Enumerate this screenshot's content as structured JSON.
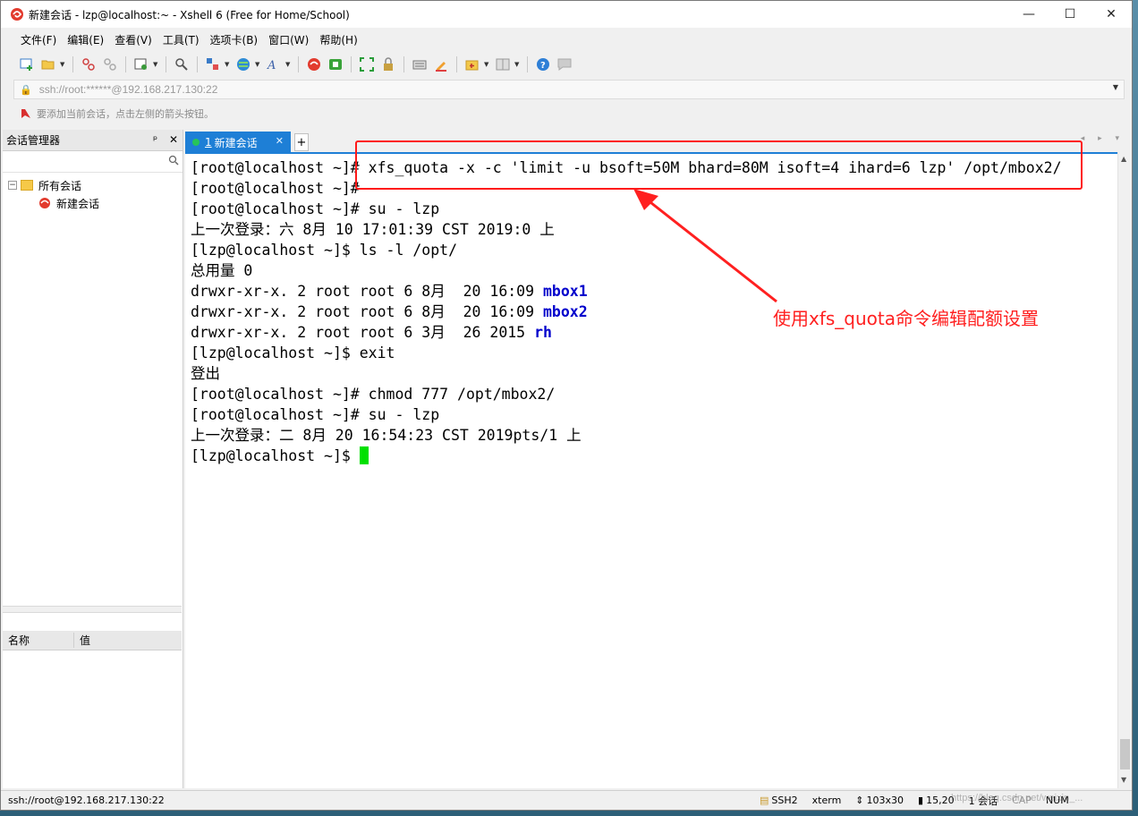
{
  "window": {
    "title": "新建会话 - lzp@localhost:~ - Xshell 6 (Free for Home/School)",
    "controls": {
      "minimize": "—",
      "maximize": "☐",
      "close": "✕"
    }
  },
  "menu": [
    "文件(F)",
    "编辑(E)",
    "查看(V)",
    "工具(T)",
    "选项卡(B)",
    "窗口(W)",
    "帮助(H)"
  ],
  "address": {
    "value": "ssh://root:******@192.168.217.130:22",
    "hint": "要添加当前会话，点击左侧的箭头按钮。"
  },
  "session_manager": {
    "title": "会话管理器",
    "pin": "ᵖ",
    "close": "✕",
    "tree": {
      "root": "所有会话",
      "root_toggle": "−",
      "child": "新建会话"
    },
    "props_headers": [
      "名称",
      "值"
    ]
  },
  "tabs": {
    "active_index": "1",
    "active_label": "新建会话",
    "close": "✕",
    "add": "+",
    "nav": "◂ ▸ ▾"
  },
  "terminal": {
    "lines": [
      {
        "text": "[root@localhost ~]# xfs_quota -x -c 'limit -u bsoft=50M bhard=80M isoft=4 ihard=6 lzp' /opt/mbox2/"
      },
      {
        "text": "[root@localhost ~]#"
      },
      {
        "text": "[root@localhost ~]# su - lzp"
      },
      {
        "text": "上一次登录：六 8月 10 17:01:39 CST 2019:0 上"
      },
      {
        "text": "[lzp@localhost ~]$ ls -l /opt/"
      },
      {
        "text": "总用量 0"
      },
      {
        "text": "drwxr-xr-x. 2 root root 6 8月  20 16:09 ",
        "dir": "mbox1"
      },
      {
        "text": "drwxr-xr-x. 2 root root 6 8月  20 16:09 ",
        "dir": "mbox2"
      },
      {
        "text": "drwxr-xr-x. 2 root root 6 3月  26 2015 ",
        "dir": "rh"
      },
      {
        "text": "[lzp@localhost ~]$ exit"
      },
      {
        "text": "登出"
      },
      {
        "text": "[root@localhost ~]# chmod 777 /opt/mbox2/"
      },
      {
        "text": "[root@localhost ~]# su - lzp"
      },
      {
        "text": "上一次登录：二 8月 20 16:54:23 CST 2019pts/1 上"
      },
      {
        "text": "[lzp@localhost ~]$ ",
        "cursor": true
      }
    ],
    "cursor_color": "#00e000",
    "dir_color": "#0000cc"
  },
  "annotation": {
    "text": "使用xfs_quota命令编辑配额设置",
    "color": "#ff2020"
  },
  "status": {
    "connection": "ssh://root@192.168.217.130:22",
    "protocol": "SSH2",
    "terminal_type": "xterm",
    "size": "103x30",
    "position": "15,20",
    "sessions": "1 会话",
    "caps": "CAP",
    "num": "NUM"
  },
  "watermark": "https://blog.csdn.net/weixin_..."
}
